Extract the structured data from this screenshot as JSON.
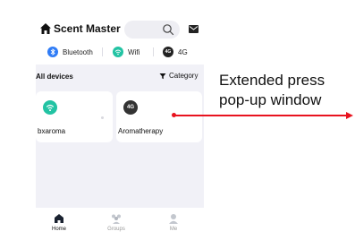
{
  "header": {
    "title": "Scent Master"
  },
  "connections": [
    {
      "label": "Bluetooth",
      "color": "#2f7cf6"
    },
    {
      "label": "Wifi",
      "color": "#22c3a3"
    },
    {
      "label": "4G",
      "color": "#222222"
    }
  ],
  "devices_section": {
    "title": "All devices",
    "category_label": "Category"
  },
  "devices": [
    {
      "name": "bxaroma",
      "icon": "wifi-icon",
      "icon_color": "#22c3a3"
    },
    {
      "name": "Aromatherapy",
      "icon": "4g-icon",
      "icon_color": "#333333"
    }
  ],
  "tabbar": [
    {
      "label": "Home",
      "icon": "home-tab-icon",
      "active": true
    },
    {
      "label": "Groups",
      "icon": "groups-tab-icon",
      "active": false
    },
    {
      "label": "Me",
      "icon": "me-tab-icon",
      "active": false
    }
  ],
  "annotation": {
    "line1": "Extended press",
    "line2": "pop-up window",
    "arrow_color": "#e8131f"
  }
}
